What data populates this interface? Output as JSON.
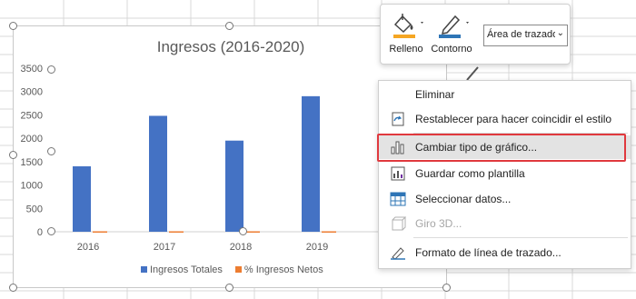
{
  "chart_data": {
    "type": "bar",
    "title": "Ingresos (2016-2020)",
    "categories": [
      "2016",
      "2017",
      "2018",
      "2019"
    ],
    "series": [
      {
        "name": "Ingresos Totales",
        "values": [
          1400,
          2480,
          1950,
          2900
        ],
        "color": "#4472c4"
      },
      {
        "name": "% Ingresos Netos",
        "values": [
          10,
          10,
          10,
          10
        ],
        "color": "#ed7d31"
      }
    ],
    "y_ticks": [
      "0",
      "500",
      "1000",
      "1500",
      "2000",
      "2500",
      "3000",
      "3500"
    ],
    "ylim": [
      0,
      3500
    ],
    "grid": false,
    "legend_position": "bottom"
  },
  "toolbar": {
    "fill_label": "Relleno",
    "outline_label": "Contorno",
    "dropdown_value": "Área de trazado",
    "fill_color": "#f5a623",
    "outline_color": "#2e75b6"
  },
  "menu": {
    "items": [
      {
        "label": "Eliminar",
        "icon": "delete-icon"
      },
      {
        "label": "Restablecer para hacer coincidir el estilo",
        "icon": "reset-style-icon"
      },
      {
        "label": "Cambiar tipo de gráfico...",
        "icon": "bar-chart-icon"
      },
      {
        "label": "Guardar como plantilla",
        "icon": "save-template-icon"
      },
      {
        "label": "Seleccionar datos...",
        "icon": "select-data-icon"
      },
      {
        "label": "Giro 3D...",
        "icon": "rotate-3d-icon"
      },
      {
        "label": "Formato de línea de trazado...",
        "icon": "format-line-icon"
      }
    ]
  },
  "colors": {
    "highlight_border": "#e0393e",
    "accent_blue": "#4472c4",
    "accent_orange": "#ed7d31"
  }
}
